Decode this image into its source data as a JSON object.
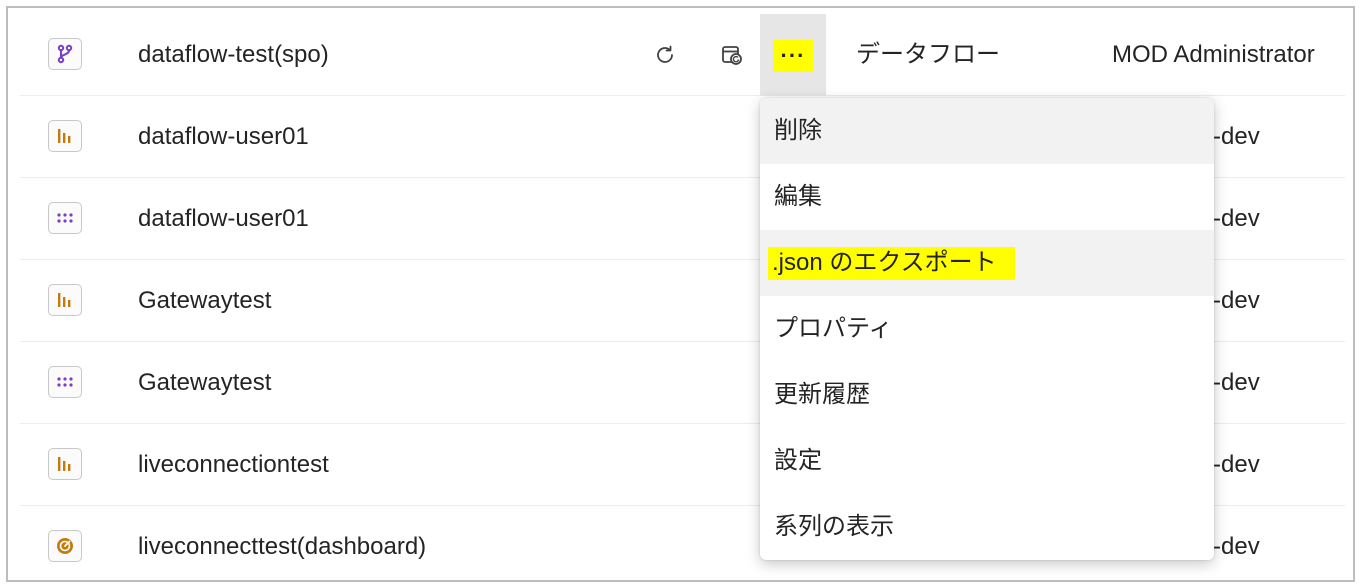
{
  "list": {
    "rows": [
      {
        "name": "dataflow-test(spo)",
        "icon": "dataflow-icon",
        "owner": ""
      },
      {
        "name": "dataflow-user01",
        "icon": "report-icon",
        "owner": "te-dev"
      },
      {
        "name": "dataflow-user01",
        "icon": "dataset-icon",
        "owner": "te-dev"
      },
      {
        "name": "Gatewaytest",
        "icon": "report-icon",
        "owner": "te-dev"
      },
      {
        "name": "Gatewaytest",
        "icon": "dataset-icon",
        "owner": "te-dev"
      },
      {
        "name": "liveconnectiontest",
        "icon": "report-icon",
        "owner": "te-dev"
      },
      {
        "name": "liveconnecttest(dashboard)",
        "icon": "dashboard-icon",
        "owner": "te-dev"
      }
    ],
    "first_row": {
      "more_label": "···",
      "type": "データフロー",
      "owner": "MOD Administrator"
    }
  },
  "context_menu": {
    "items": [
      {
        "label": "削除"
      },
      {
        "label": "編集"
      },
      {
        "label": ".json のエクスポート"
      },
      {
        "label": "プロパティ"
      },
      {
        "label": "更新履歴"
      },
      {
        "label": "設定"
      },
      {
        "label": "系列の表示"
      }
    ]
  },
  "colors": {
    "highlight": "#ffff00",
    "dataflow_icon": "#7b3fc4",
    "report_icon": "#c27c0e",
    "dataset_icon": "#7b3fc4",
    "dashboard_icon": "#c27c0e"
  }
}
